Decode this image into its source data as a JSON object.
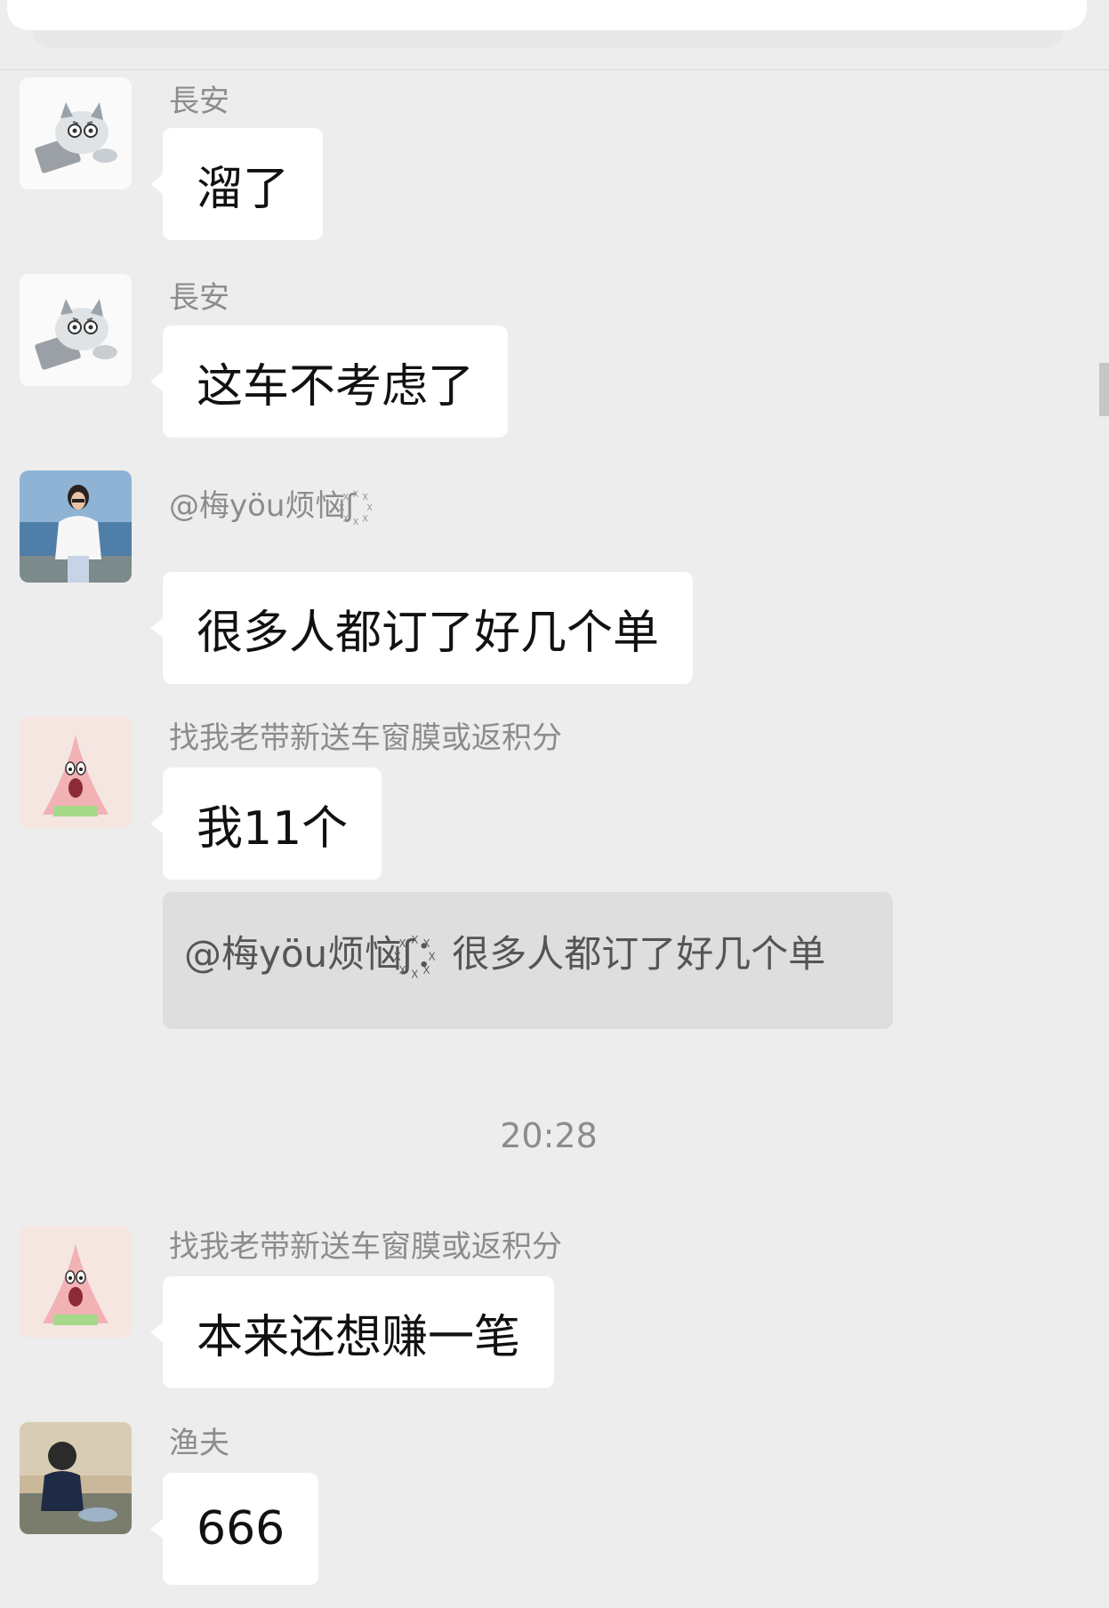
{
  "timestamp": "20:28",
  "messages": [
    {
      "sender": "長安",
      "text": "溜了",
      "avatar": "cat-avatar"
    },
    {
      "sender": "長安",
      "text": "这车不考虑了",
      "avatar": "cat-avatar"
    },
    {
      "sender": "@梅yöu烦恼ʃ꙰",
      "text": "很多人都订了好几个单",
      "avatar": "woman-seaside-avatar"
    },
    {
      "sender": "找我老带新送车窗膜或返积分",
      "text": "我11个",
      "avatar": "patrick-star-avatar",
      "quote": "@梅yöu烦恼ʃ꙰：很多人都订了好几个单"
    },
    {
      "sender": "找我老带新送车窗膜或返积分",
      "text": "本来还想赚一笔",
      "avatar": "patrick-star-avatar"
    },
    {
      "sender": "渔夫",
      "text": "666",
      "avatar": "child-back-avatar"
    }
  ]
}
